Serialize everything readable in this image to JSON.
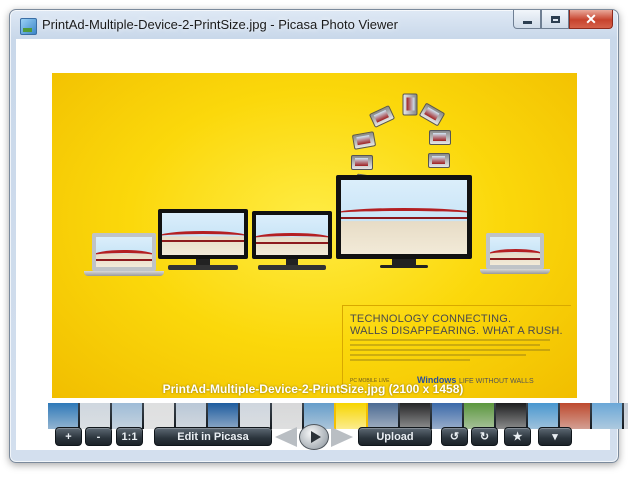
{
  "window": {
    "title": "PrintAd-Multiple-Device-2-PrintSize.jpg - Picasa Photo Viewer",
    "controls": {
      "minimize": "minimize",
      "maximize": "maximize",
      "close": "✕"
    }
  },
  "photo": {
    "ad_headline_line1": "TECHNOLOGY CONNECTING.",
    "ad_headline_line2": "WALLS DISAPPEARING. WHAT A RUSH.",
    "ad_footer": "PC   MOBILE   LIVE",
    "ad_logo": "Windows",
    "ad_tagline": "LIFE WITHOUT WALLS",
    "caption": "PrintAd-Multiple-Device-2-PrintSize.jpg (2100 x 1458)"
  },
  "toolbar": {
    "zoom_in": "+",
    "zoom_out": "-",
    "actual_size": "1:1",
    "edit": "Edit in Picasa",
    "upload": "Upload",
    "rotate_left": "↺",
    "rotate_right": "↻",
    "star": "★",
    "more": "▾"
  },
  "colors": {
    "ad_background": "#fbd80b",
    "toolbar_button": "#2b343c",
    "close_button": "#c7432d"
  },
  "filmstrip": {
    "thumb_colors": [
      "#2d7fc4",
      "#dfe7ef",
      "#a9c9e6",
      "#f0f0f0",
      "#c7d6e6",
      "#1b5fa8",
      "#dfe6ee",
      "#e8e8e8",
      "#6aa7d8",
      "#f7d500",
      "#4e6f9a",
      "#222222",
      "#3b6db3",
      "#5fa03c",
      "#1a1a1a",
      "#4aa0de",
      "#cc4a2a",
      "#6fb2e6",
      "#d6dde6"
    ],
    "active_index": 9
  }
}
